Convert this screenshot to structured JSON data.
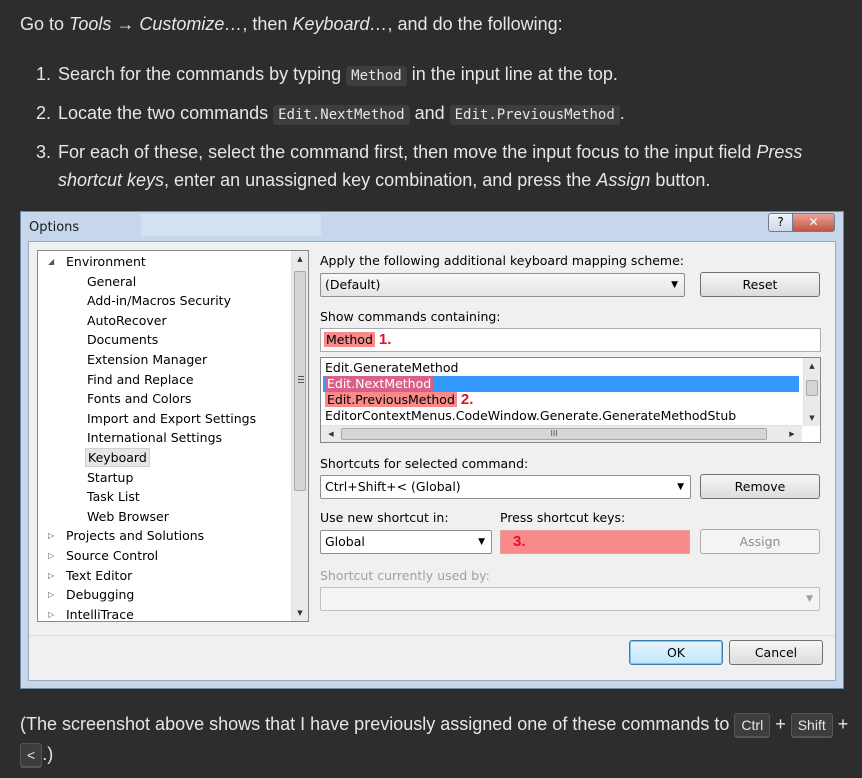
{
  "intro": {
    "go_to": "Go to ",
    "tools_path": "Tools → Customize…",
    "then": ", then ",
    "keyboard": "Keyboard…",
    "rest": ", and do the following:"
  },
  "steps": [
    {
      "num": "1.",
      "a": "Search for the commands by typing ",
      "code": "Method",
      "b": " in the input line at the top."
    },
    {
      "num": "2.",
      "a": "Locate the two commands ",
      "code1": "Edit.NextMethod",
      "and": " and ",
      "code2": "Edit.PreviousMethod",
      "end": "."
    },
    {
      "num": "3.",
      "a": "For each of these, select the command first, then move the input focus to the input field ",
      "em1": "Press shortcut keys",
      "b": ", enter an unassigned key combination, and press the ",
      "em2": "Assign",
      "c": " button."
    }
  ],
  "dialog": {
    "title": "Options",
    "help_icon": "?",
    "close_icon": "✕",
    "tree": [
      {
        "label": "Environment",
        "level": 0,
        "arrow": "◢"
      },
      {
        "label": "General",
        "level": 1
      },
      {
        "label": "Add-in/Macros Security",
        "level": 1
      },
      {
        "label": "AutoRecover",
        "level": 1
      },
      {
        "label": "Documents",
        "level": 1
      },
      {
        "label": "Extension Manager",
        "level": 1
      },
      {
        "label": "Find and Replace",
        "level": 1
      },
      {
        "label": "Fonts and Colors",
        "level": 1
      },
      {
        "label": "Import and Export Settings",
        "level": 1
      },
      {
        "label": "International Settings",
        "level": 1
      },
      {
        "label": "Keyboard",
        "level": 1,
        "selected": true
      },
      {
        "label": "Startup",
        "level": 1
      },
      {
        "label": "Task List",
        "level": 1
      },
      {
        "label": "Web Browser",
        "level": 1
      },
      {
        "label": "Projects and Solutions",
        "level": 0,
        "arrow": "▷"
      },
      {
        "label": "Source Control",
        "level": 0,
        "arrow": "▷"
      },
      {
        "label": "Text Editor",
        "level": 0,
        "arrow": "▷"
      },
      {
        "label": "Debugging",
        "level": 0,
        "arrow": "▷"
      },
      {
        "label": "IntelliTrace",
        "level": 0,
        "arrow": "▷"
      }
    ],
    "mapping_label": "Apply the following additional keyboard mapping scheme:",
    "mapping_value": "(Default)",
    "reset": "Reset",
    "show_label": "Show commands containing:",
    "search_value": "Method",
    "marker1": "1.",
    "commands": [
      "Edit.GenerateMethod",
      "Edit.NextMethod",
      "Edit.PreviousMethod",
      "EditorContextMenus.CodeWindow.Generate.GenerateMethodStub"
    ],
    "marker2": "2.",
    "shortcuts_label": "Shortcuts for selected command:",
    "shortcut_value": "Ctrl+Shift+< (Global)",
    "remove": "Remove",
    "use_new_label": "Use new shortcut in:",
    "use_new_value": "Global",
    "press_label": "Press shortcut keys:",
    "marker3": "3.",
    "assign": "Assign",
    "used_by_label": "Shortcut currently used by:",
    "ok": "OK",
    "cancel": "Cancel"
  },
  "footer": {
    "a": "(The screenshot above shows that I have previously assigned one of these commands to ",
    "k1": "Ctrl",
    "plus1": " + ",
    "k2": "Shift",
    "plus2": " + ",
    "k3": "<",
    "end": ".)"
  },
  "colors": {
    "background": "#2d2d2d",
    "highlight_red": "#f88a8a",
    "selection_blue": "#3399ff",
    "marker_red": "#e4102a"
  }
}
